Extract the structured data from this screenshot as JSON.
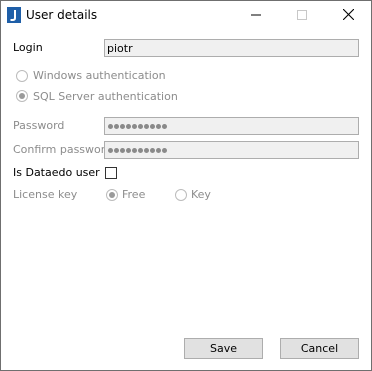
{
  "window": {
    "title": "User details"
  },
  "form": {
    "login_label": "Login",
    "login_value": "piotr",
    "auth_windows_label": "Windows authentication",
    "auth_sql_label": "SQL Server authentication",
    "password_label": "Password",
    "confirm_password_label": "Confirm password",
    "is_dataedo_user_label": "Is Dataedo user",
    "license_key_label": "License key",
    "license_free_label": "Free",
    "license_key_option_label": "Key"
  },
  "buttons": {
    "save": "Save",
    "cancel": "Cancel"
  },
  "icons": {
    "app": "app-icon",
    "minimize": "minimize-icon",
    "maximize": "maximize-icon",
    "close": "close-icon"
  }
}
